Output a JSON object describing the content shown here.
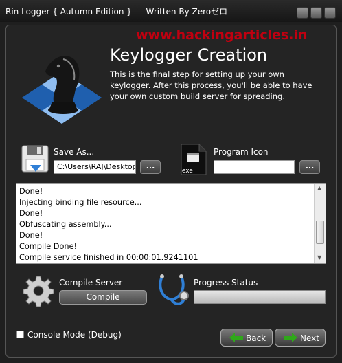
{
  "window": {
    "title": "Rin Logger  { Autumn Edition } --- Written By Zeroゼロ"
  },
  "watermark": "www.hackingarticles.in",
  "header": {
    "title": "Keylogger Creation",
    "description": "This is the final step for setting up your own keylogger. After this process, you'll be able to have your own custom build server for spreading."
  },
  "save_as": {
    "label": "Save As...",
    "value": "C:\\Users\\RAJ\\Desktop",
    "browse_label": "..."
  },
  "program_icon": {
    "label": "Program Icon",
    "value": "",
    "browse_label": "...",
    "icon_caption": ".exe"
  },
  "console": {
    "lines": [
      "Done!",
      "Injecting binding file resource...",
      "Done!",
      "Obfuscating assembly...",
      "Done!",
      "Compile Done!",
      "Compile service finished in 00:00:01.9241101"
    ]
  },
  "compile": {
    "label": "Compile Server",
    "button_label": "Compile"
  },
  "progress": {
    "label": "Progress Status",
    "value": 0
  },
  "options": {
    "console_mode_label": "Console Mode (Debug)",
    "console_mode_checked": false
  },
  "nav": {
    "back_label": "Back",
    "next_label": "Next"
  },
  "colors": {
    "watermark": "#c00010",
    "arrow": "#2fa81a",
    "background": "#242424"
  }
}
